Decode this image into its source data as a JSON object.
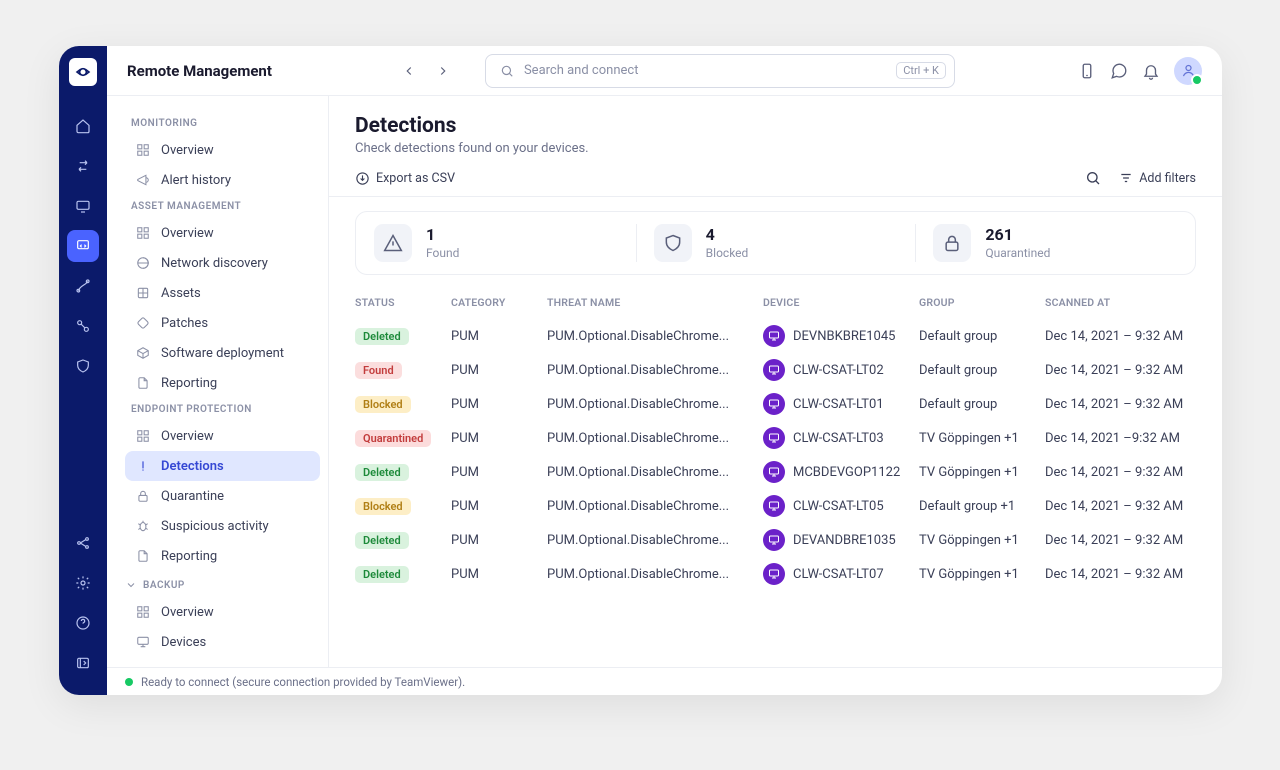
{
  "appTitle": "Remote Management",
  "search": {
    "placeholder": "Search and connect",
    "shortcut": "Ctrl + K"
  },
  "sidebar": {
    "monitoring": {
      "label": "MONITORING",
      "overview": "Overview",
      "alert": "Alert history"
    },
    "asset": {
      "label": "ASSET MANAGEMENT",
      "overview": "Overview",
      "network": "Network discovery",
      "assets": "Assets",
      "patches": "Patches",
      "deploy": "Software deployment",
      "reporting": "Reporting"
    },
    "endpoint": {
      "label": "ENDPOINT PROTECTION",
      "overview": "Overview",
      "detections": "Detections",
      "quarantine": "Quarantine",
      "suspicious": "Suspicious activity",
      "reporting": "Reporting"
    },
    "backup": {
      "label": "BACKUP",
      "overview": "Overview",
      "devices": "Devices"
    }
  },
  "page": {
    "title": "Detections",
    "subtitle": "Check detections found on your devices."
  },
  "toolbar": {
    "export": "Export as CSV",
    "filters": "Add filters"
  },
  "stats": {
    "found_n": "1",
    "found_l": "Found",
    "blocked_n": "4",
    "blocked_l": "Blocked",
    "quar_n": "261",
    "quar_l": "Quarantined"
  },
  "cols": {
    "status": "STATUS",
    "category": "CATEGORY",
    "threat": "THREAT NAME",
    "device": "DEVICE",
    "group": "GROUP",
    "scanned": "SCANNED AT"
  },
  "rows": [
    {
      "status": "Deleted",
      "category": "PUM",
      "threat": "PUM.Optional.DisableChrome...",
      "device": "DEVNBKBRE1045",
      "group": "Default group",
      "scanned": "Dec 14, 2021 – 9:32 AM"
    },
    {
      "status": "Found",
      "category": "PUM",
      "threat": "PUM.Optional.DisableChrome...",
      "device": "CLW-CSAT-LT02",
      "group": "Default group",
      "scanned": "Dec 14, 2021 – 9:32 AM"
    },
    {
      "status": "Blocked",
      "category": "PUM",
      "threat": "PUM.Optional.DisableChrome...",
      "device": "CLW-CSAT-LT01",
      "group": "Default group",
      "scanned": "Dec 14, 2021 – 9:32 AM"
    },
    {
      "status": "Quarantined",
      "category": "PUM",
      "threat": "PUM.Optional.DisableChrome...",
      "device": "CLW-CSAT-LT03",
      "group": "TV Göppingen +1",
      "scanned": "Dec 14, 2021 –9:32 AM"
    },
    {
      "status": "Deleted",
      "category": "PUM",
      "threat": "PUM.Optional.DisableChrome...",
      "device": "MCBDEVGOP1122",
      "group": "TV Göppingen +1",
      "scanned": "Dec 14, 2021 – 9:32 AM"
    },
    {
      "status": "Blocked",
      "category": "PUM",
      "threat": "PUM.Optional.DisableChrome...",
      "device": "CLW-CSAT-LT05",
      "group": "Default group +1",
      "scanned": "Dec 14, 2021 – 9:32 AM"
    },
    {
      "status": "Deleted",
      "category": "PUM",
      "threat": "PUM.Optional.DisableChrome...",
      "device": "DEVANDBRE1035",
      "group": "TV Göppingen +1",
      "scanned": "Dec 14, 2021 – 9:32 AM"
    },
    {
      "status": "Deleted",
      "category": "PUM",
      "threat": "PUM.Optional.DisableChrome...",
      "device": "CLW-CSAT-LT07",
      "group": "TV Göppingen +1",
      "scanned": "Dec 14, 2021 – 9:32 AM"
    }
  ],
  "footer": "Ready to connect (secure connection provided by TeamViewer)."
}
